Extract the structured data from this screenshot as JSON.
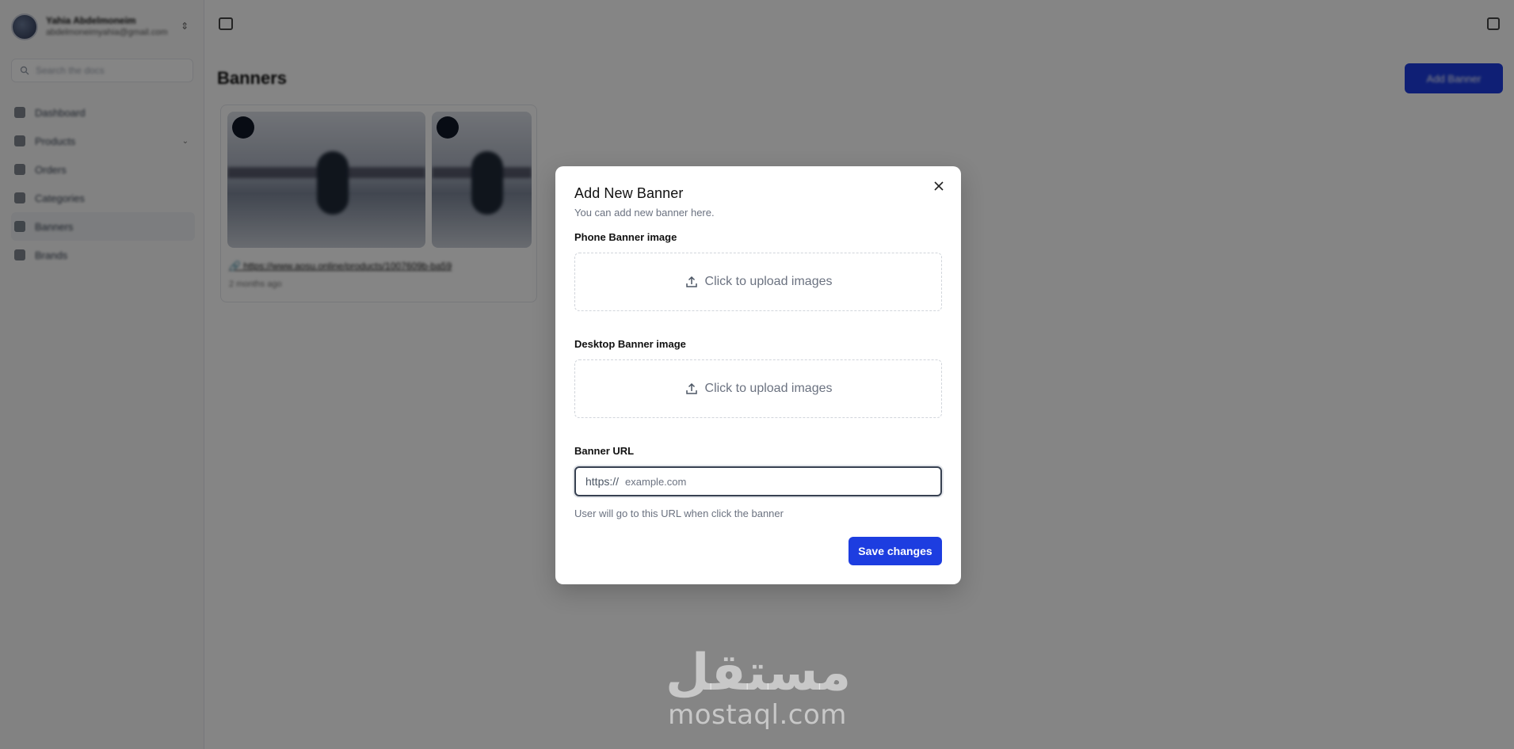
{
  "sidebar": {
    "user": {
      "name": "Yahia Abdelmoneim",
      "email": "abdelmoneimyahia@gmail.com"
    },
    "search_placeholder": "Search the docs",
    "items": [
      {
        "label": "Dashboard",
        "active": false
      },
      {
        "label": "Products",
        "active": false,
        "expandable": true
      },
      {
        "label": "Orders",
        "active": false
      },
      {
        "label": "Categories",
        "active": false
      },
      {
        "label": "Banners",
        "active": true
      },
      {
        "label": "Brands",
        "active": false
      }
    ]
  },
  "main": {
    "title": "Banners",
    "add_button": "Add Banner",
    "banner": {
      "link": "https://www.aosu.online/products/1007609b-ba59",
      "time": "2 months ago"
    }
  },
  "modal": {
    "title": "Add New Banner",
    "description": "You can add new banner here.",
    "phone_label": "Phone Banner image",
    "phone_upload": "Click to upload images",
    "desktop_label": "Desktop Banner image",
    "desktop_upload": "Click to upload images",
    "url_label": "Banner URL",
    "url_prefix": "https://",
    "url_value": "",
    "url_placeholder": "example.com",
    "url_hint": "User will go to this URL when click the banner",
    "save_button": "Save changes"
  },
  "watermark": {
    "arabic": "مستقل",
    "latin": "mostaql.com"
  },
  "colors": {
    "primary": "#1d3de0",
    "overlay": "rgba(0,0,0,0.48)"
  }
}
